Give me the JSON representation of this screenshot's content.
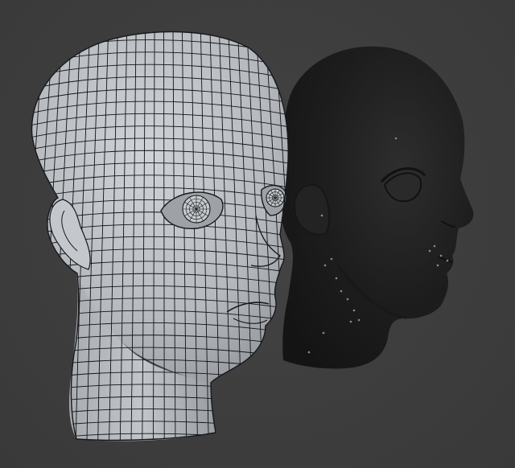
{
  "viewport": {
    "background_color": "#3d3d3d",
    "objects": [
      {
        "id": "wireframe-head",
        "shading": "solid-with-wireframe",
        "base_color": "#b9bcc0",
        "wire_color": "#111418",
        "facing": "three-quarter-right"
      },
      {
        "id": "dark-head",
        "shading": "solid-dark",
        "base_color": "#1b1b1b",
        "highlight_color": "#2c2c2c",
        "facing": "right-profile",
        "vertex_markers_color": "#8a8a8a"
      }
    ]
  }
}
